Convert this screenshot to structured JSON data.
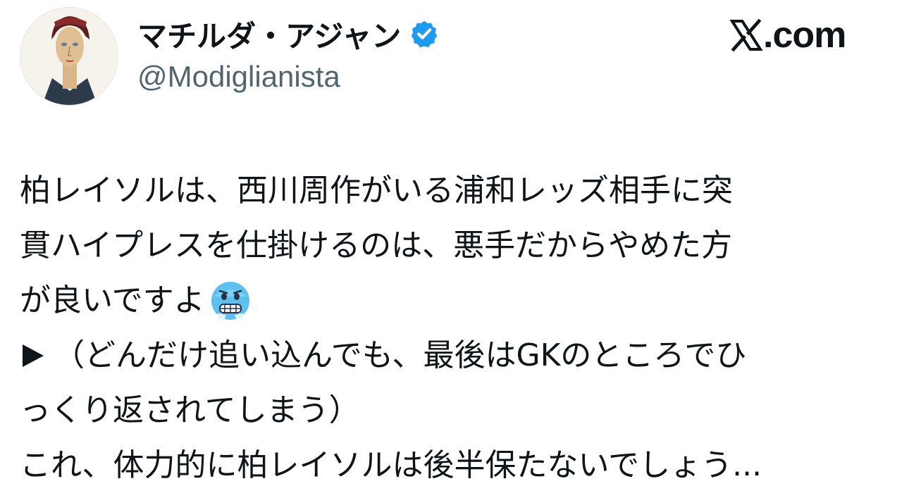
{
  "header": {
    "display_name": "マチルダ・アジャン",
    "handle": "@Modiglianista",
    "verified_icon": "verified-badge-icon",
    "avatar_icon": "avatar-portrait",
    "brand_logo_icon": "x-logo-icon",
    "brand_text": ".com"
  },
  "tweet": {
    "lines": [
      "柏レイソルは、西川周作がいる浦和レッズ相手に突",
      "貫ハイプレスを仕掛けるのは、悪手だからやめた方",
      "が良いですよ",
      "（どんだけ追い込んでも、最後はGKのところでひ",
      "っくり返されてしまう）",
      "これ、体力的に柏レイソルは後半保たないでしょう..."
    ],
    "emoji_icon": "freezing-face-emoji",
    "bullet_icon": "play-triangle-icon"
  },
  "colors": {
    "text": "#0f1419",
    "secondary": "#536471",
    "verified": "#1d9bf0",
    "background": "#ffffff"
  }
}
